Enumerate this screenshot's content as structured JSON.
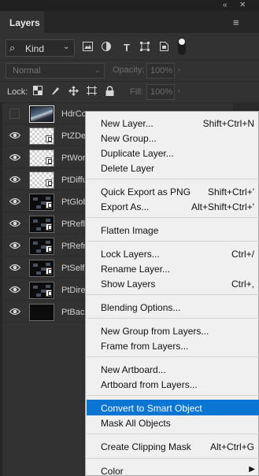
{
  "panel": {
    "collapse_glyph": "«",
    "close_glyph": "✕",
    "tab_label": "Layers",
    "menu_glyph": "≡"
  },
  "filter": {
    "search_glyph": "⌕",
    "kind_label": "Kind",
    "chevron": "⌄",
    "icons": [
      "image-filter-icon",
      "adjustment-filter-icon",
      "type-filter-icon",
      "shape-filter-icon",
      "smart-object-filter-icon"
    ]
  },
  "blend": {
    "mode_value": "Normal",
    "opacity_label": "Opacity:",
    "opacity_value": "100%",
    "chevron": "⌄"
  },
  "lock": {
    "label": "Lock:",
    "fill_label": "Fill:",
    "fill_value": "100%"
  },
  "layers": [
    {
      "name": "HdrCo",
      "visible": false,
      "thumb": "photo"
    },
    {
      "name": "PtZDe",
      "visible": true,
      "thumb": "checker"
    },
    {
      "name": "PtWor",
      "visible": true,
      "thumb": "checker"
    },
    {
      "name": "PtDiffu",
      "visible": true,
      "thumb": "checker"
    },
    {
      "name": "PtGlob",
      "visible": true,
      "thumb": "dark"
    },
    {
      "name": "PtRefle",
      "visible": true,
      "thumb": "dark"
    },
    {
      "name": "PtRefr",
      "visible": true,
      "thumb": "dark"
    },
    {
      "name": "PtSelf",
      "visible": true,
      "thumb": "dark"
    },
    {
      "name": "PtDire",
      "visible": true,
      "thumb": "dark"
    },
    {
      "name": "PtBack",
      "visible": true,
      "thumb": "black"
    }
  ],
  "context_menu": {
    "items": [
      {
        "label": "New Layer...",
        "shortcut": "Shift+Ctrl+N"
      },
      {
        "label": "New Group...",
        "shortcut": ""
      },
      {
        "label": "Duplicate Layer...",
        "shortcut": ""
      },
      {
        "label": "Delete Layer",
        "shortcut": ""
      },
      {
        "label": "Quick Export as PNG",
        "shortcut": "Shift+Ctrl+'"
      },
      {
        "label": "Export As...",
        "shortcut": "Alt+Shift+Ctrl+'"
      },
      {
        "label": "Flatten Image",
        "shortcut": ""
      },
      {
        "label": "Lock Layers...",
        "shortcut": "Ctrl+/"
      },
      {
        "label": "Rename Layer...",
        "shortcut": ""
      },
      {
        "label": "Show Layers",
        "shortcut": "Ctrl+,"
      },
      {
        "label": "Blending Options...",
        "shortcut": ""
      },
      {
        "label": "New Group from Layers...",
        "shortcut": ""
      },
      {
        "label": "Frame from Layers...",
        "shortcut": ""
      },
      {
        "label": "New Artboard...",
        "shortcut": ""
      },
      {
        "label": "Artboard from Layers...",
        "shortcut": ""
      },
      {
        "label": "Convert to Smart Object",
        "shortcut": "",
        "highlighted": true
      },
      {
        "label": "Mask All Objects",
        "shortcut": ""
      },
      {
        "label": "Create Clipping Mask",
        "shortcut": "Alt+Ctrl+G"
      },
      {
        "label": "Color",
        "shortcut": "",
        "submenu": true
      }
    ]
  },
  "colors": {
    "panel_bg": "#323232",
    "menu_bg": "#f0f0f0",
    "menu_highlight": "#0a75d2"
  }
}
